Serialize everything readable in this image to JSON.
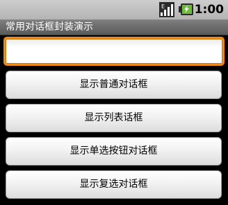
{
  "status_bar": {
    "time": "1:00",
    "icons": [
      "signal-icon",
      "battery-icon"
    ]
  },
  "title_bar": {
    "title": "常用对话框封装演示"
  },
  "edit_field": {
    "value": "",
    "placeholder": ""
  },
  "buttons": [
    {
      "label": "显示普通对话框"
    },
    {
      "label": "显示列表话框"
    },
    {
      "label": "显示单选按钮对话框"
    },
    {
      "label": "显示复选对话框"
    }
  ],
  "colors": {
    "focus_border": "#f08a1b",
    "title_bar": "#6b6b6b",
    "status_bar": "#c0c0c0",
    "background": "#000000"
  }
}
